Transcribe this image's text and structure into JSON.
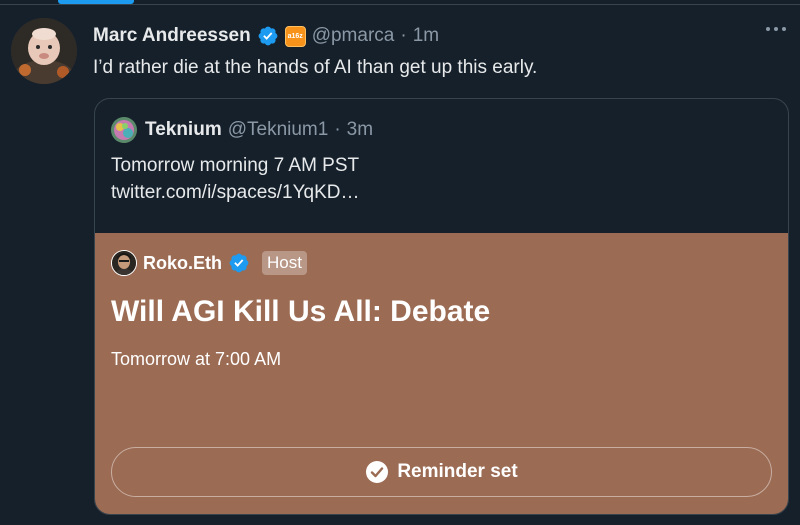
{
  "tweet": {
    "author_name": "Marc Andreessen",
    "affiliation_badge": "a16z",
    "handle": "@pmarca",
    "separator": "·",
    "time": "1m",
    "text": "I’d rather die at the hands of AI than get up this early."
  },
  "quote": {
    "author_name": "Teknium",
    "handle": "@Teknium1",
    "separator": "·",
    "time": "3m",
    "text_line1": "Tomorrow morning 7 AM PST",
    "text_line2": "twitter.com/i/spaces/1YqKD…"
  },
  "space": {
    "host_name": "Roko.Eth",
    "host_badge": "Host",
    "title": "Will AGI Kill Us All: Debate",
    "scheduled": "Tomorrow at 7:00 AM",
    "reminder_label": "Reminder set",
    "background_color": "#9b6b54"
  },
  "colors": {
    "background": "#15202b",
    "accent": "#1d9bf0",
    "secondary_text": "#8b98a5"
  }
}
